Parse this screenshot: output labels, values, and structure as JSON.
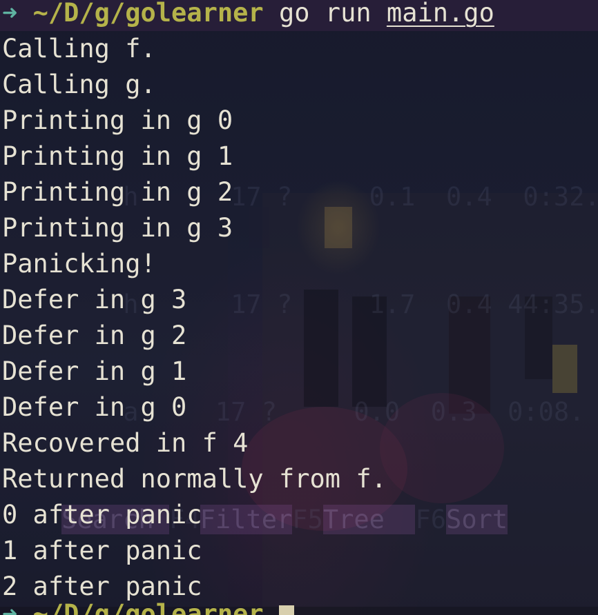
{
  "prompt": {
    "arrow": "➜",
    "path": "~/D/g/golearner",
    "command": "go run",
    "file": "main.go"
  },
  "output": [
    "Calling f.",
    "Calling g.",
    "Printing in g 0",
    "Printing in g 1",
    "Printing in g 2",
    "Printing in g 3",
    "Panicking!",
    "Defer in g 3",
    "Defer in g 2",
    "Defer in g 1",
    "Defer in g 0",
    "Recovered in f 4",
    "Returned normally from f.",
    "0 after panic",
    "1 after panic",
    "2 after panic"
  ],
  "next_prompt": {
    "arrow": "➜",
    "path": "~/D/g/golearner"
  },
  "colors": {
    "prompt_arrow": "#5fb3a1",
    "prompt_path": "#b5b34a",
    "output_text": "#e6e2d3",
    "cursor": "#d8cfae",
    "background": "#1a1d30"
  }
}
